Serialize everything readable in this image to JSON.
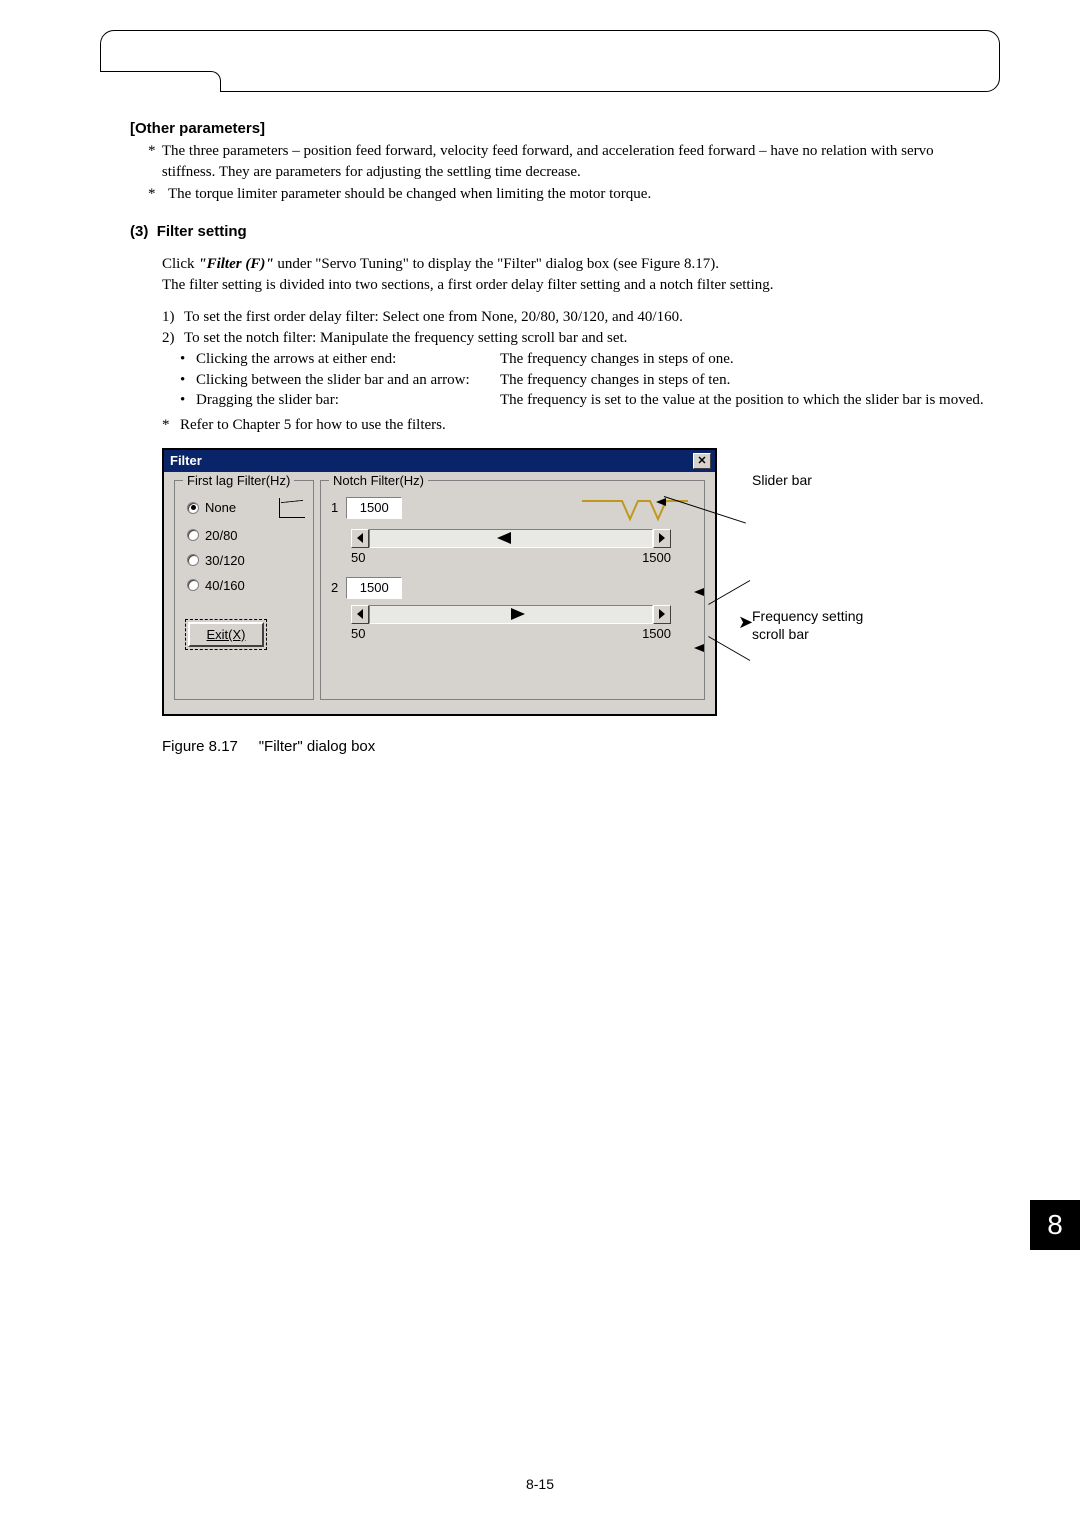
{
  "section_other": {
    "heading": "[Other parameters]",
    "items": [
      "The three parameters – position feed forward, velocity feed forward, and acceleration feed forward – have no relation with servo stiffness. They are parameters for adjusting the settling time decrease.",
      "The torque limiter parameter should be changed when limiting the motor torque."
    ]
  },
  "filter_setting": {
    "number": "(3)",
    "title": "Filter setting",
    "click_line_pre": "Click ",
    "click_bold": "\"Filter (F)\"",
    "click_line_post": " under \"Servo Tuning\" to display the \"Filter\" dialog box (see Figure 8.17).",
    "divided": "The filter setting is divided into two sections, a first order delay filter setting and a notch filter setting.",
    "step1": "To set the first order delay filter: Select one from None, 20/80, 30/120, and 40/160.",
    "step2": "To set the notch filter: Manipulate the frequency setting scroll bar and set.",
    "rows": [
      {
        "left": "Clicking the arrows at either end:",
        "right": "The frequency changes in steps of one."
      },
      {
        "left": "Clicking between the slider bar and an arrow:",
        "right": "The frequency changes in steps of ten."
      },
      {
        "left": "Dragging the slider bar:",
        "right": "The frequency is set to the value at the position to which the slider bar is moved."
      }
    ],
    "refer": "Refer to Chapter 5 for how to use the filters."
  },
  "dialog": {
    "title": "Filter",
    "group1": {
      "legend": "First lag Filter(Hz)",
      "options": [
        "None",
        "20/80",
        "30/120",
        "40/160"
      ],
      "selected": 0,
      "exit": "Exit(X)"
    },
    "group2": {
      "legend": "Notch Filter(Hz)",
      "label1": "1",
      "val1": "1500",
      "min": "50",
      "max": "1500",
      "label2": "2",
      "val2": "1500",
      "min2": "50",
      "max2": "1500"
    }
  },
  "callouts": {
    "slider_bar": "Slider bar",
    "freq_line1": "Frequency setting",
    "freq_line2": "scroll bar"
  },
  "figure_caption": {
    "num": "Figure 8.17",
    "text": "\"Filter\" dialog box"
  },
  "page_tab": "8",
  "page_footer": "8-15"
}
